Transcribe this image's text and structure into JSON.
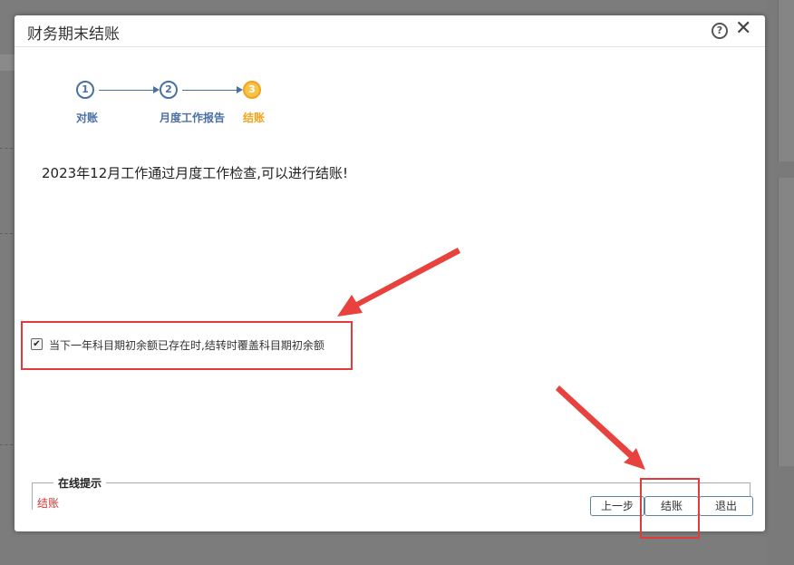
{
  "dialog": {
    "title": "财务期末结账",
    "steps": [
      {
        "number": "1",
        "label": "对账",
        "active": false
      },
      {
        "number": "2",
        "label": "月度工作报告",
        "active": false
      },
      {
        "number": "3",
        "label": "结账",
        "active": true
      }
    ],
    "message": "2023年12月工作通过月度工作检查,可以进行结账!",
    "checkbox": {
      "label": "当下一年科目期初余额已存在时,结转时覆盖科目期初余额",
      "checked": true
    },
    "hint": {
      "legend": "在线提示",
      "text": "结账"
    },
    "buttons": {
      "prev": "上一步",
      "close_account": "结账",
      "exit": "退出"
    }
  },
  "colors": {
    "step_blue": "#4a6fa5",
    "step_active": "#f0a41e",
    "annotation_red": "#e23b3b",
    "hint_text": "#dd3333"
  },
  "icons": [
    "help-icon",
    "close-icon",
    "checkmark-icon"
  ]
}
